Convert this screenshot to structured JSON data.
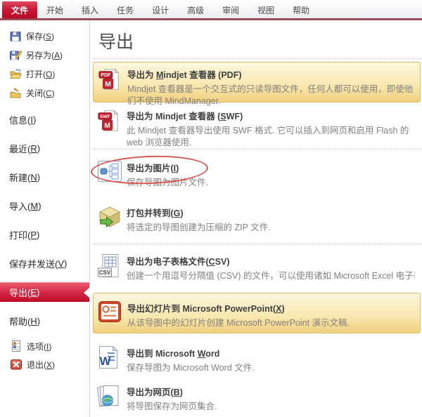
{
  "colors": {
    "accent_red": "#c11534",
    "tab_active_gradient_top": "#dd4a60",
    "tab_active_gradient_bottom": "#ba0a27",
    "selected_nav_gradient_top": "#e9596b",
    "selected_nav_gradient_bottom": "#bd0c2a",
    "highlight_yellow_top": "#fdf7e0",
    "highlight_yellow_bottom": "#f0cf7d",
    "highlight_border": "#e0bd67",
    "annotation_red": "#da564c"
  },
  "tabs": {
    "items": [
      {
        "label": "文件",
        "active": true
      },
      {
        "label": "开始"
      },
      {
        "label": "插入"
      },
      {
        "label": "任务"
      },
      {
        "label": "设计"
      },
      {
        "label": "高级"
      },
      {
        "label": "审阅"
      },
      {
        "label": "视图"
      },
      {
        "label": "帮助"
      }
    ]
  },
  "sidebar": {
    "items": [
      {
        "pre": "保存(",
        "key": "S",
        "post": ")",
        "icon": "save-icon"
      },
      {
        "pre": "另存为(",
        "key": "A",
        "post": ")",
        "icon": "save-as-icon"
      },
      {
        "pre": "打开(",
        "key": "O",
        "post": ")",
        "icon": "open-folder-icon"
      },
      {
        "pre": "关闭(",
        "key": "C",
        "post": ")",
        "icon": "close-folder-icon"
      },
      {
        "pre": "信息(",
        "key": "I",
        "post": ")"
      },
      {
        "pre": "最近(",
        "key": "R",
        "post": ")"
      },
      {
        "pre": "新建(",
        "key": "N",
        "post": ")"
      },
      {
        "pre": "导入(",
        "key": "M",
        "post": ")"
      },
      {
        "pre": "打印(",
        "key": "P",
        "post": ")"
      },
      {
        "pre": "保存并发送(",
        "key": "V",
        "post": ")"
      },
      {
        "pre": "导出(",
        "key": "E",
        "post": ")",
        "selected": true
      },
      {
        "pre": "帮助(",
        "key": "H",
        "post": ")"
      },
      {
        "pre": "选项(",
        "key": "I",
        "post": ")",
        "icon": "options-icon"
      },
      {
        "pre": "退出(",
        "key": "X",
        "post": ")",
        "icon": "exit-icon"
      }
    ]
  },
  "main": {
    "title": "导出",
    "items": [
      {
        "icon": "mindjet-pdf-viewer-icon",
        "highlight": true,
        "title_pre": "导出为 ",
        "title_key": "M",
        "title_post": "indjet 查看器 (PDF)",
        "desc": "Mindjet 查看器是一个交互式的只读导图文件，任何人都可以使用，即使他们不使用 MindManager."
      },
      {
        "icon": "mindjet-swf-viewer-icon",
        "title_pre": "导出为 Mindjet 查看器 (",
        "title_key": "S",
        "title_post": "WF)",
        "desc": "此 Mindjet 查看器导出使用 SWF 格式. 它可以插入到网页和启用 Flash 的 web 浏览器使用."
      },
      {
        "icon": "export-image-icon",
        "title_pre": "导出为图片(",
        "title_key": "I",
        "title_post": ")",
        "desc": "保存导图为图片文件."
      },
      {
        "icon": "pack-and-go-icon",
        "title_pre": "打包并转到(",
        "title_key": "G",
        "title_post": ")",
        "desc": "将选定的导图创建为压缩的 ZIP 文件."
      },
      {
        "icon": "csv-spreadsheet-icon",
        "title_pre": "导出为电子表格文件(",
        "title_key": "C",
        "title_post": "SV)",
        "desc": "创建一个用逗号分隔值 (CSV) 的文件，可以使用诸如 Microsoft Excel 电子表格来打开."
      },
      {
        "icon": "powerpoint-icon",
        "highlight": true,
        "title_pre": "导出幻灯片到 Microsoft PowerPoint(",
        "title_key": "X",
        "title_post": ")",
        "desc": "从该导图中的幻灯片创建 Microsoft PowerPoint 演示文稿."
      },
      {
        "icon": "word-icon",
        "title_pre": "导出到 Microsoft ",
        "title_key": "W",
        "title_post": "ord",
        "desc": "保存导图为 Microsoft Word 文件."
      },
      {
        "icon": "webpage-icon",
        "title_pre": "导出为网页(",
        "title_key": "B",
        "title_post": ")",
        "desc": "将导图保存为网页集合."
      }
    ]
  },
  "annotation": {
    "type": "red-ellipse",
    "circles": "导出为图片(I)",
    "color": "#da564c"
  },
  "icon_badges": {
    "pdf": "PDF",
    "swf": "SWF",
    "csv": "CSV",
    "viewer_logo": "M",
    "word_logo": "W"
  }
}
